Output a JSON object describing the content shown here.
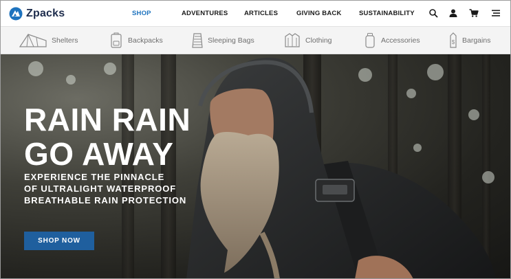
{
  "brand": {
    "name": "Zpacks",
    "color": "#1d2c4c"
  },
  "nav": {
    "links": [
      {
        "label": "SHOP",
        "active": true
      },
      {
        "label": "ADVENTURES",
        "active": false
      },
      {
        "label": "ARTICLES",
        "active": false
      },
      {
        "label": "GIVING BACK",
        "active": false
      },
      {
        "label": "SUSTAINABILITY",
        "active": false
      }
    ],
    "icons": [
      "search-icon",
      "account-icon",
      "cart-icon",
      "menu-icon"
    ],
    "active_color": "#1e73be"
  },
  "categories": [
    {
      "label": "Shelters",
      "icon": "tent-icon"
    },
    {
      "label": "Backpacks",
      "icon": "backpack-icon"
    },
    {
      "label": "Sleeping Bags",
      "icon": "sleeping-bag-icon"
    },
    {
      "label": "Clothing",
      "icon": "jacket-icon"
    },
    {
      "label": "Accessories",
      "icon": "bottle-icon"
    },
    {
      "label": "Bargains",
      "icon": "price-tag-icon"
    }
  ],
  "hero": {
    "title_line1": "RAIN RAIN",
    "title_line2": "GO AWAY",
    "subtitle_line1": "EXPERIENCE THE PINNACLE",
    "subtitle_line2": "OF ULTRALIGHT WATERPROOF",
    "subtitle_line3": "BREATHABLE RAIN PROTECTION",
    "cta_label": "SHOP NOW",
    "cta_color": "#1f5f9e"
  }
}
